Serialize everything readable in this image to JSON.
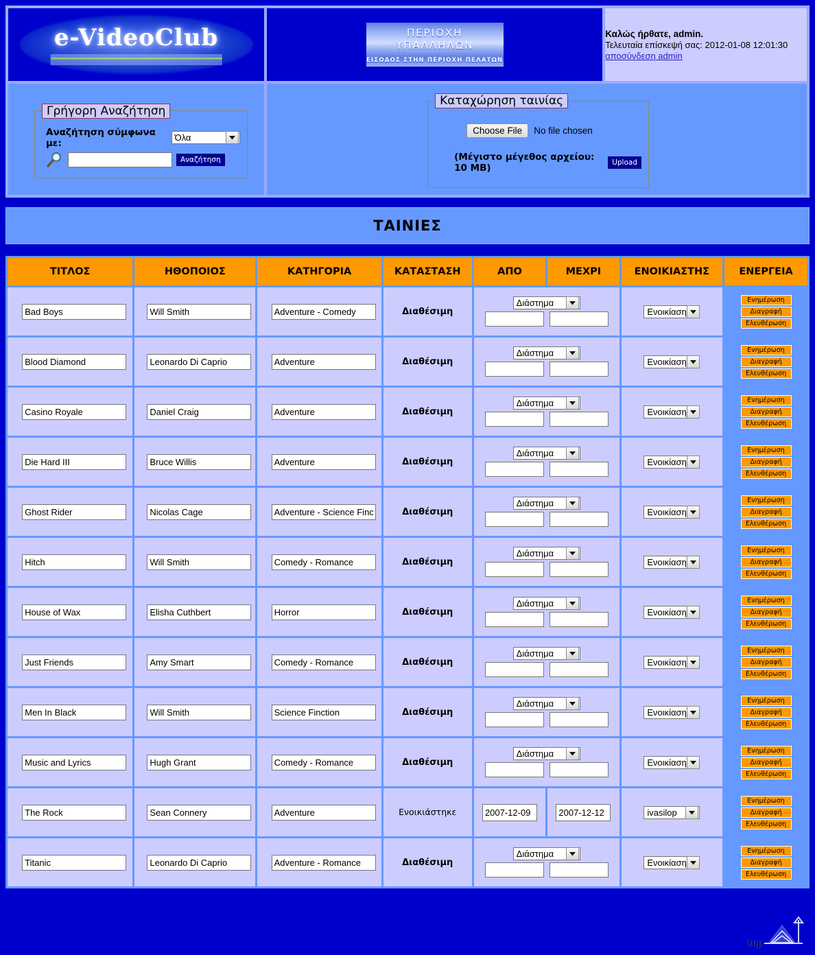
{
  "header": {
    "logo_text": "e-VideoClub",
    "banner_line1": "ΠΕΡΙΟΧΗ ΥΠΑΛΛΗΛΩΝ",
    "banner_line2": "ΕΙΣΟΔΟΣ ΣΤΗΝ ΠΕΡΙΟΧΗ ΠΕΛΑΤΩΝ",
    "welcome": "Καλώς ήρθατε, admin.",
    "last_visit": "Τελευταία επίσκεψή σας: 2012-01-08 12:01:30",
    "logout_link": "αποσύνδεση admin"
  },
  "search": {
    "legend": "Γρήγορη Αναζήτηση",
    "label": "Αναζήτηση σύμφωνα με:",
    "filter_selected": "Όλα",
    "filter_options": [
      "Όλα"
    ],
    "input_value": "",
    "input_placeholder": "",
    "button_label": "Αναζήτηση"
  },
  "upload": {
    "legend": "Καταχώρηση ταινίας",
    "choose_file_label": "Choose File",
    "file_status": "No file chosen",
    "max_size_note": "(Μέγιστο μέγεθος αρχείου: 10 MB)",
    "upload_button": "Upload"
  },
  "section": {
    "title": "ΤΑΙΝΙΕΣ"
  },
  "table": {
    "columns": [
      "ΤΙΤΛΟΣ",
      "ΗΘΟΠΟΙΟΣ",
      "ΚΑΤΗΓΟΡΙΑ",
      "ΚΑΤΑΣΤΑΣΗ",
      "ΑΠΟ",
      "ΜΕΧΡΙ",
      "ΕΝΟΙΚΙΑΣΤΗΣ",
      "ΕΝΕΡΓΕΙΑ"
    ],
    "actions": {
      "update": "Ενημέρωση",
      "delete": "Διαγραφή",
      "release": "Ελευθέρωση"
    },
    "defaults": {
      "period_select": "Διάστημα",
      "renter_select": "Ενοικίαση",
      "status_available": "Διαθέσιμη",
      "status_rented": "Ενοικιάστηκε"
    },
    "rows": [
      {
        "title": "Bad Boys",
        "actor": "Will Smith",
        "category": "Adventure - Comedy",
        "status": "Διαθέσιμη",
        "rented": false,
        "period": "Διάστημα",
        "from": "",
        "until": "",
        "renter": "Ενοικίαση"
      },
      {
        "title": "Blood Diamond",
        "actor": "Leonardo Di Caprio",
        "category": "Adventure",
        "status": "Διαθέσιμη",
        "rented": false,
        "period": "Διάστημα",
        "from": "",
        "until": "",
        "renter": "Ενοικίαση"
      },
      {
        "title": "Casino Royale",
        "actor": "Daniel Craig",
        "category": "Adventure",
        "status": "Διαθέσιμη",
        "rented": false,
        "period": "Διάστημα",
        "from": "",
        "until": "",
        "renter": "Ενοικίαση"
      },
      {
        "title": "Die Hard III",
        "actor": "Bruce Willis",
        "category": "Adventure",
        "status": "Διαθέσιμη",
        "rented": false,
        "period": "Διάστημα",
        "from": "",
        "until": "",
        "renter": "Ενοικίαση"
      },
      {
        "title": "Ghost Rider",
        "actor": "Nicolas Cage",
        "category": "Adventure - Science Finct",
        "status": "Διαθέσιμη",
        "rented": false,
        "period": "Διάστημα",
        "from": "",
        "until": "",
        "renter": "Ενοικίαση"
      },
      {
        "title": "Hitch",
        "actor": "Will Smith",
        "category": "Comedy - Romance",
        "status": "Διαθέσιμη",
        "rented": false,
        "period": "Διάστημα",
        "from": "",
        "until": "",
        "renter": "Ενοικίαση"
      },
      {
        "title": "House of Wax",
        "actor": "Elisha Cuthbert",
        "category": "Horror",
        "status": "Διαθέσιμη",
        "rented": false,
        "period": "Διάστημα",
        "from": "",
        "until": "",
        "renter": "Ενοικίαση"
      },
      {
        "title": "Just Friends",
        "actor": "Amy Smart",
        "category": "Comedy - Romance",
        "status": "Διαθέσιμη",
        "rented": false,
        "period": "Διάστημα",
        "from": "",
        "until": "",
        "renter": "Ενοικίαση"
      },
      {
        "title": "Men In Black",
        "actor": "Will Smith",
        "category": "Science Finction",
        "status": "Διαθέσιμη",
        "rented": false,
        "period": "Διάστημα",
        "from": "",
        "until": "",
        "renter": "Ενοικίαση"
      },
      {
        "title": "Music and Lyrics",
        "actor": "Hugh Grant",
        "category": "Comedy - Romance",
        "status": "Διαθέσιμη",
        "rented": false,
        "period": "Διάστημα",
        "from": "",
        "until": "",
        "renter": "Ενοικίαση"
      },
      {
        "title": "The Rock",
        "actor": "Sean Connery",
        "category": "Adventure",
        "status": "Ενοικιάστηκε",
        "rented": true,
        "period": "",
        "from": "2007-12-09",
        "until": "2007-12-12",
        "renter": "ivasilop"
      },
      {
        "title": "Titanic",
        "actor": "Leonardo Di Caprio",
        "category": "Adventure - Romance",
        "status": "Διαθέσιμη",
        "rented": false,
        "period": "Διάστημα",
        "from": "",
        "until": "",
        "renter": "Ενοικίαση"
      }
    ]
  },
  "footer": {
    "top_label": "top"
  },
  "colors": {
    "page_bg": "#0000cc",
    "panel_bg": "#6699ff",
    "cell_bg": "#ccccff",
    "header_orange": "#ff9900",
    "button_blue": "#000099"
  }
}
